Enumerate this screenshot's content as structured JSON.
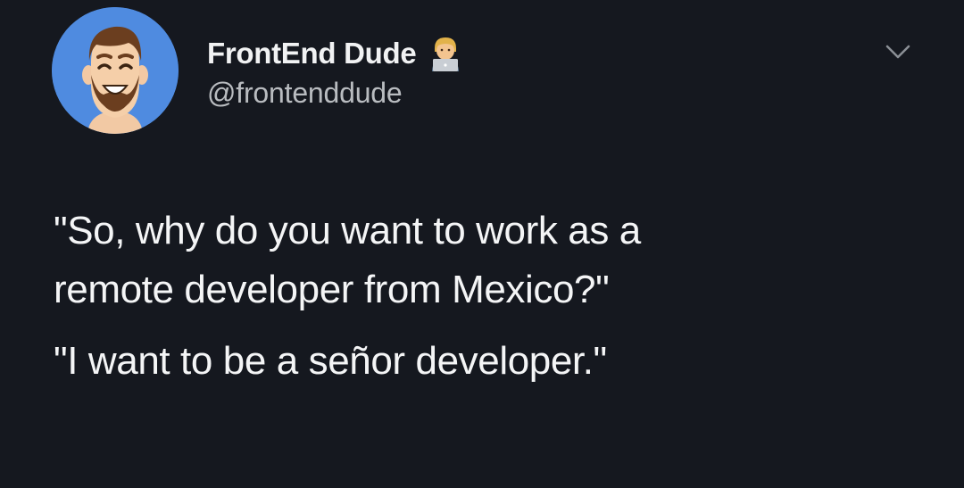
{
  "author": {
    "display_name": "FrontEnd Dude",
    "handle": "@frontenddude",
    "badge_icon": "developer-at-laptop-emoji-icon",
    "avatar_icon": "bearded-man-avatar-icon"
  },
  "menu": {
    "icon": "chevron-down-icon"
  },
  "tweet": {
    "line_1": "\"So, why do you want to work as a",
    "line_2": "remote developer from Mexico?\"",
    "paragraph_2": "\"I want to be a señor developer.\""
  },
  "colors": {
    "background": "#15181f",
    "avatar_bg": "#4f8be0",
    "text_primary": "#f4f5f6",
    "text_secondary": "#b9bcc0"
  }
}
